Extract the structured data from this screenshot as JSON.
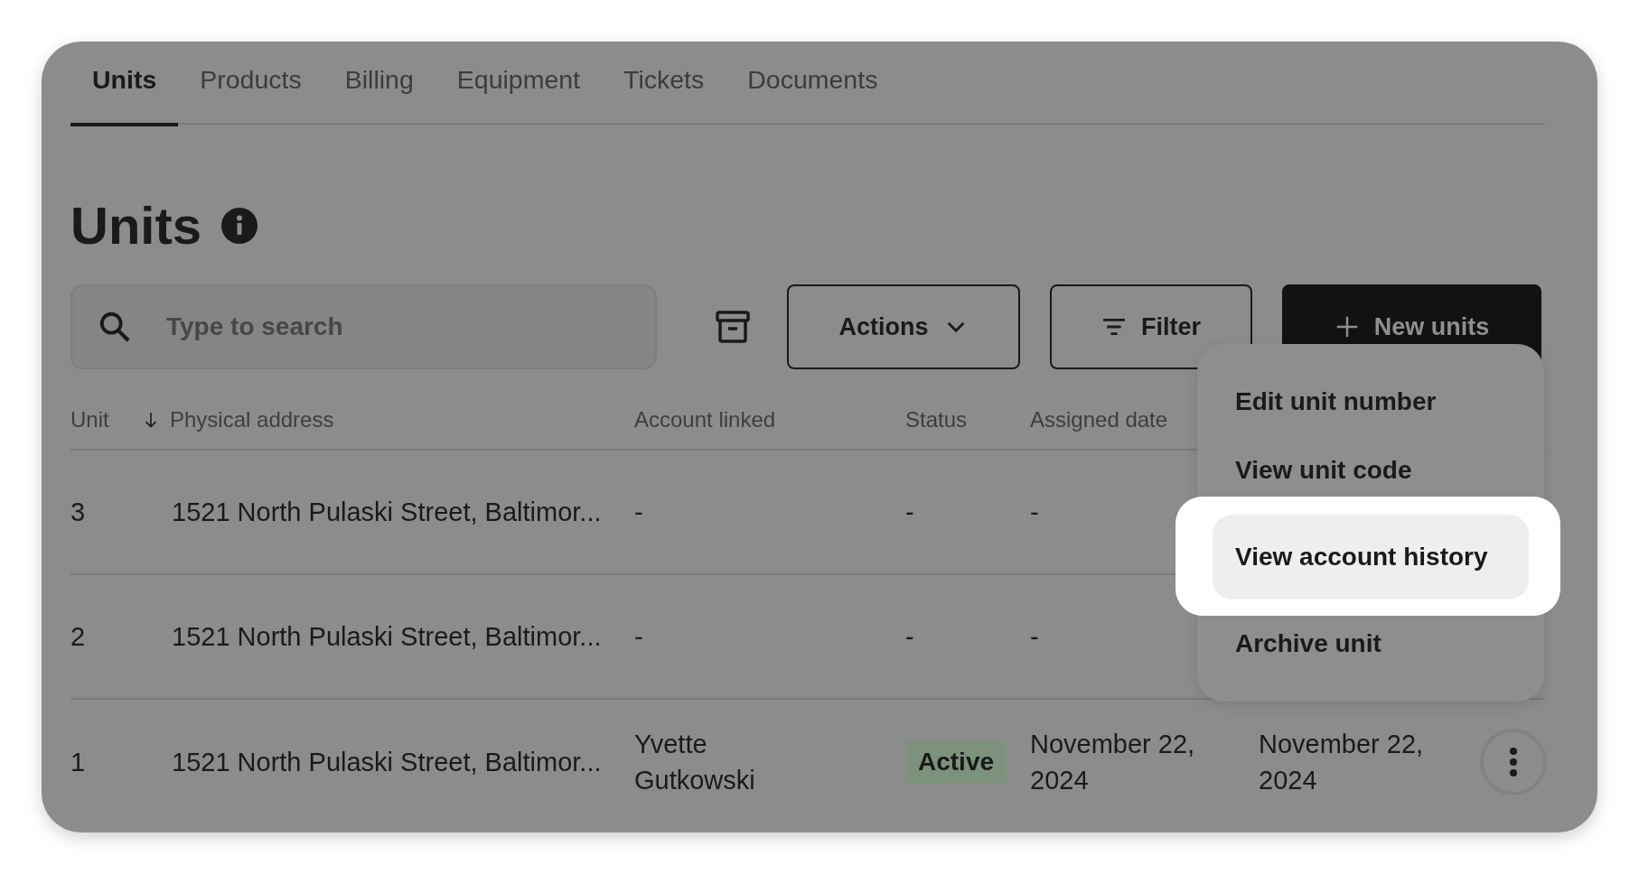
{
  "tabs": [
    {
      "label": "Units",
      "selected": true
    },
    {
      "label": "Products",
      "selected": false
    },
    {
      "label": "Billing",
      "selected": false
    },
    {
      "label": "Equipment",
      "selected": false
    },
    {
      "label": "Tickets",
      "selected": false
    },
    {
      "label": "Documents",
      "selected": false
    }
  ],
  "page_title": "Units",
  "search": {
    "placeholder": "Type to search"
  },
  "buttons": [
    {
      "label": "Actions",
      "kind": "dropdown"
    },
    {
      "label": "Filter",
      "kind": "filter"
    },
    {
      "label": "New units",
      "kind": "primary"
    }
  ],
  "table": {
    "columns": [
      {
        "label": "Unit",
        "sorted": true
      },
      {
        "label": "Physical address",
        "sorted": false
      },
      {
        "label": "Account linked",
        "sorted": false
      },
      {
        "label": "Status",
        "sorted": false
      },
      {
        "label": "Assigned date",
        "sorted": false
      }
    ],
    "rows": [
      {
        "unit": "3",
        "address": "1521 North Pulaski Street, Baltimor...",
        "account": "-",
        "status": {
          "text": "-",
          "kind": "plain"
        },
        "assigned_date": "-",
        "menu_button": false
      },
      {
        "unit": "2",
        "address": "1521 North Pulaski Street, Baltimor...",
        "account": "-",
        "status": {
          "text": "-",
          "kind": "plain"
        },
        "assigned_date": "-",
        "menu_button": false
      },
      {
        "unit": "1",
        "address": "1521 North Pulaski Street, Baltimor...",
        "account": "Yvette Gutkowski",
        "status": {
          "text": "Active",
          "kind": "badge"
        },
        "assigned_date": "November 22, 2024",
        "column_6": "November 22, 2024",
        "menu_button": true
      }
    ]
  },
  "context_menu": {
    "items": [
      {
        "label": "Edit unit number",
        "selected": false
      },
      {
        "label": "View unit code",
        "selected": false
      },
      {
        "label": "View account history",
        "selected": true
      },
      {
        "label": "Archive unit",
        "selected": false
      }
    ]
  }
}
